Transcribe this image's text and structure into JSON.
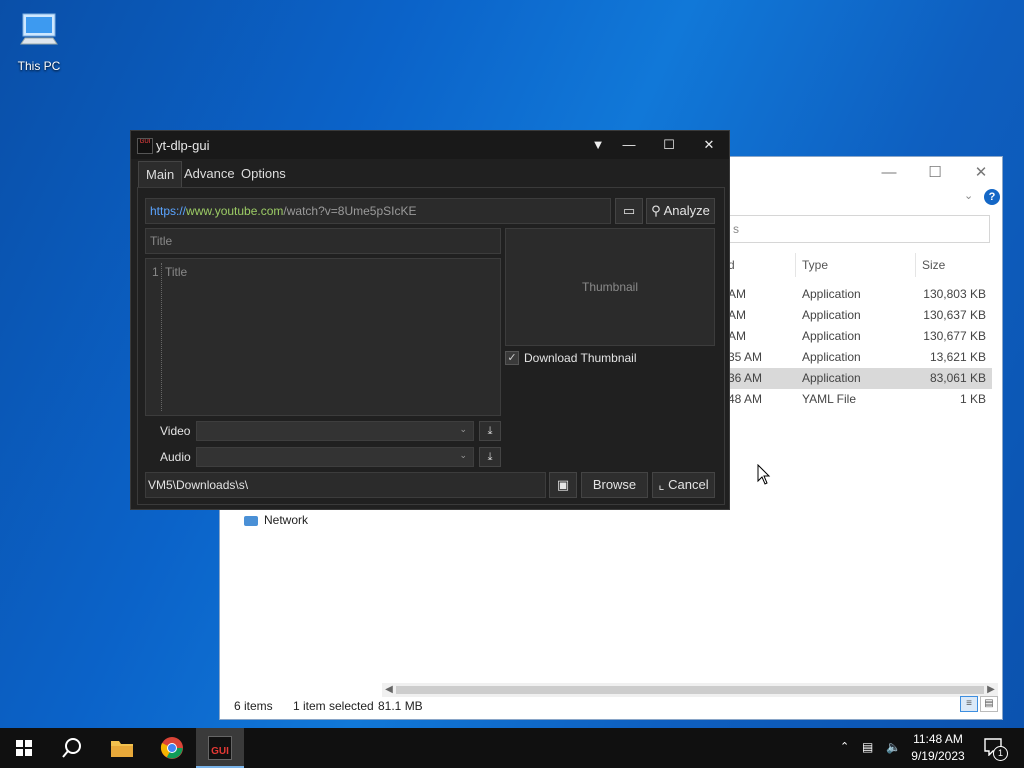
{
  "desktop": {
    "icon_label": "This PC"
  },
  "explorer": {
    "search_placeholder": "s",
    "columns": {
      "type": "Type",
      "size": "Size"
    },
    "rows": [
      {
        "date": "AM",
        "type": "Application",
        "size": "130,803 KB",
        "selected": false
      },
      {
        "date": "AM",
        "type": "Application",
        "size": "130,637 KB",
        "selected": false
      },
      {
        "date": "AM",
        "type": "Application",
        "size": "130,677 KB",
        "selected": false
      },
      {
        "date": "35 AM",
        "type": "Application",
        "size": "13,621 KB",
        "selected": false
      },
      {
        "date": "36 AM",
        "type": "Application",
        "size": "83,061 KB",
        "selected": true
      },
      {
        "date": "48 AM",
        "type": "YAML File",
        "size": "1 KB",
        "selected": false
      }
    ],
    "nav_network": "Network",
    "status": {
      "items": "6 items",
      "selected": "1 item selected",
      "size": "81.1 MB"
    }
  },
  "ytdlp": {
    "title": "yt-dlp-gui",
    "app_icon_text": "GUI",
    "tabs": [
      "Main",
      "Advance",
      "Options"
    ],
    "url": {
      "scheme": "https://",
      "host": "www.youtube.com",
      "path": "/watch?v=8Ume5pSIcKE"
    },
    "analyze_label": "Analyze",
    "title_placeholder": "Title",
    "description": {
      "line_number": "1",
      "text": "Title"
    },
    "thumbnail_label": "Thumbnail",
    "download_thumbnail_label": "Download Thumbnail",
    "download_thumbnail_checked": true,
    "video_label": "Video",
    "audio_label": "Audio",
    "path_value": "VM5\\Downloads\\s\\",
    "browse_label": "Browse",
    "cancel_label": "Cancel"
  },
  "taskbar": {
    "time": "11:48 AM",
    "date": "9/19/2023",
    "notification_count": "1"
  }
}
